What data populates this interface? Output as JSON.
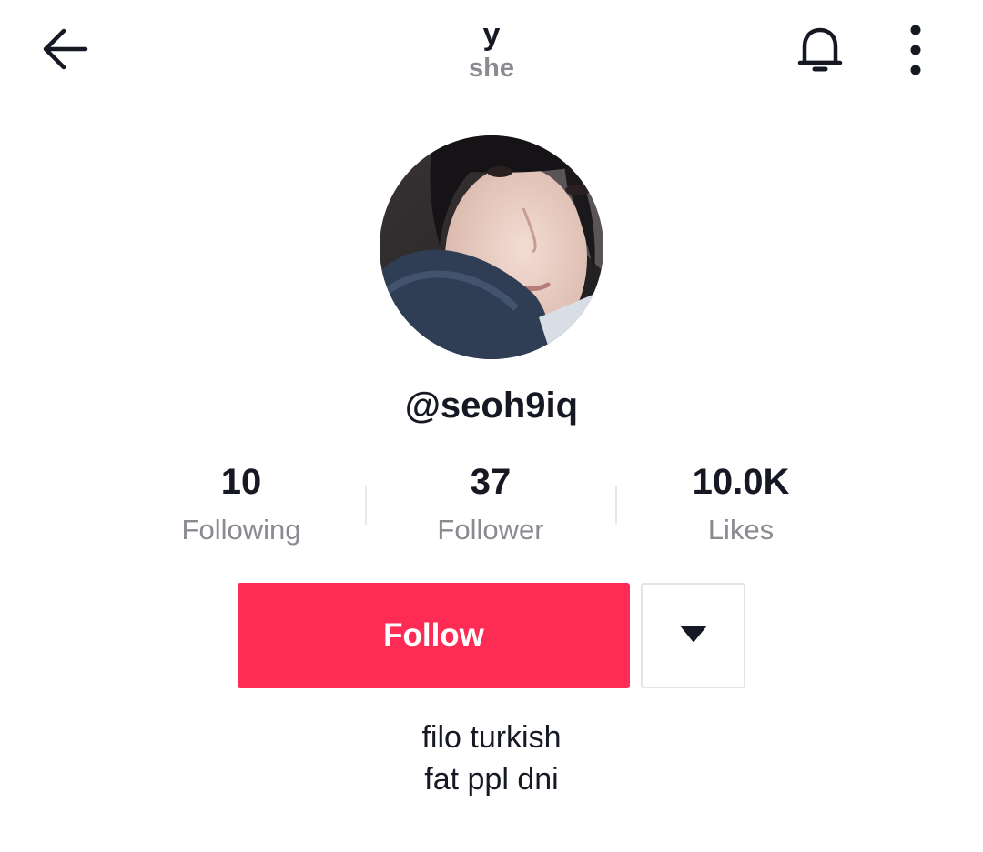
{
  "header": {
    "display_name": "y",
    "pronouns": "she",
    "back_icon": "arrow-left-icon",
    "bell_icon": "bell-icon",
    "more_icon": "vertical-dots-icon"
  },
  "profile": {
    "username": "@seoh9iq",
    "avatar": "profile-photo"
  },
  "stats": [
    {
      "value": "10",
      "label": "Following"
    },
    {
      "value": "37",
      "label": "Follower"
    },
    {
      "value": "10.0K",
      "label": "Likes"
    }
  ],
  "actions": {
    "follow_label": "Follow",
    "dropdown_icon": "caret-down-icon",
    "follow_color": "#fe2c55"
  },
  "bio": {
    "lines": [
      "filo turkish",
      "fat ppl dni"
    ]
  }
}
